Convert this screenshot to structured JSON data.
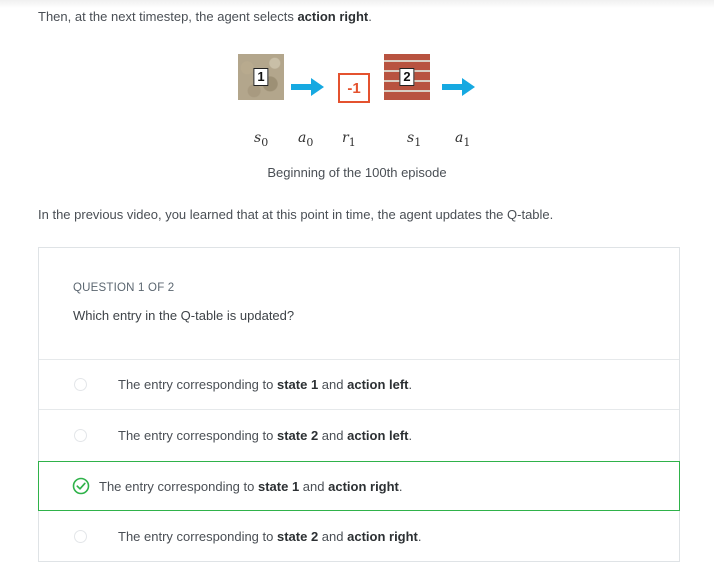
{
  "intro": {
    "prefix": "Then, at the next timestep, the agent selects ",
    "bold": "action right",
    "suffix": "."
  },
  "figure": {
    "state0_label": "1",
    "reward_label": "-1",
    "state1_label": "2",
    "symbols": [
      {
        "base": "s",
        "sub": "0"
      },
      {
        "base": "a",
        "sub": "0"
      },
      {
        "base": "r",
        "sub": "1"
      },
      {
        "base": "s",
        "sub": "1"
      },
      {
        "base": "a",
        "sub": "1"
      }
    ],
    "caption": "Beginning of the 100th episode",
    "arrow_color": "#16a9e1"
  },
  "paragraph": "In the previous video, you learned that at this point in time, the agent updates the Q-table.",
  "quiz": {
    "question_number": "QUESTION 1 OF 2",
    "question": "Which entry in the Q-table is updated?",
    "options": [
      {
        "t1": "The entry corresponding to ",
        "b1": "state 1",
        "t2": " and ",
        "b2": "action left",
        "t3": "."
      },
      {
        "t1": "The entry corresponding to ",
        "b1": "state 2",
        "t2": " and ",
        "b2": "action left",
        "t3": "."
      },
      {
        "t1": "The entry corresponding to ",
        "b1": "state 1",
        "t2": " and ",
        "b2": "action right",
        "t3": "."
      },
      {
        "t1": "The entry corresponding to ",
        "b1": "state 2",
        "t2": " and ",
        "b2": "action right",
        "t3": "."
      }
    ],
    "correct_index": 2,
    "correct_color": "#2fb24a"
  }
}
